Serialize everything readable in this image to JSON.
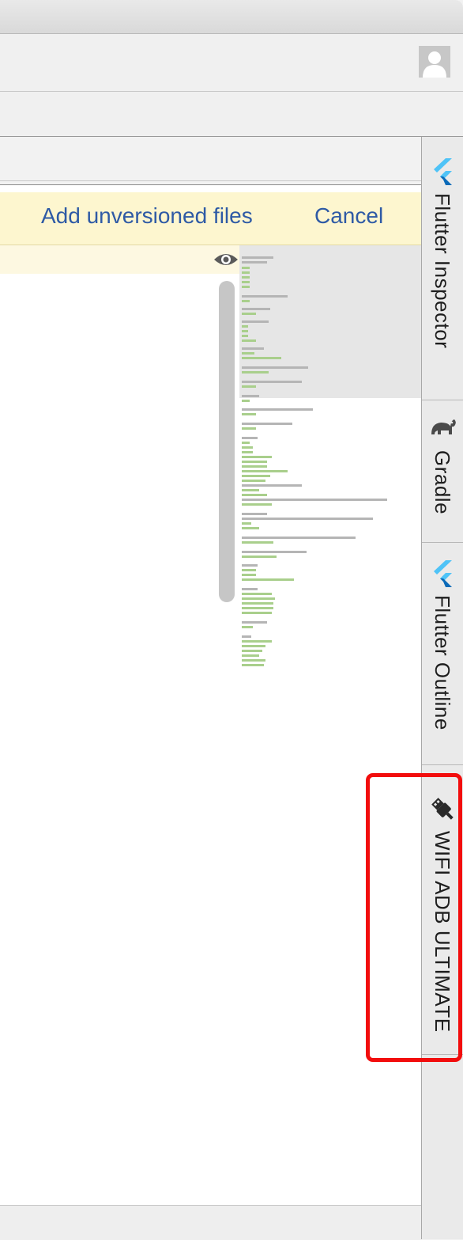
{
  "banner": {
    "add_label": "Add unversioned files",
    "cancel_label": "Cancel"
  },
  "tool_window_tabs": [
    {
      "label": "Flutter Inspector",
      "icon": "flutter-icon"
    },
    {
      "label": "Gradle",
      "icon": "gradle-elephant-icon"
    },
    {
      "label": "Flutter Outline",
      "icon": "flutter-icon"
    },
    {
      "label": "WIFI ADB ULTIMATE",
      "icon": "usb-plug-icon"
    }
  ],
  "colors": {
    "banner_background": "#fdf6cf",
    "link": "#2e5aa5",
    "highlight_border": "#f20d0d",
    "minimap_green": "#a9cf8c",
    "flutter_light": "#4fc3f7",
    "flutter_dark": "#0a6ab8"
  },
  "toolbar": {
    "avatar_icon": "user-avatar-icon"
  },
  "editor": {
    "preview_icon": "eye-icon"
  }
}
